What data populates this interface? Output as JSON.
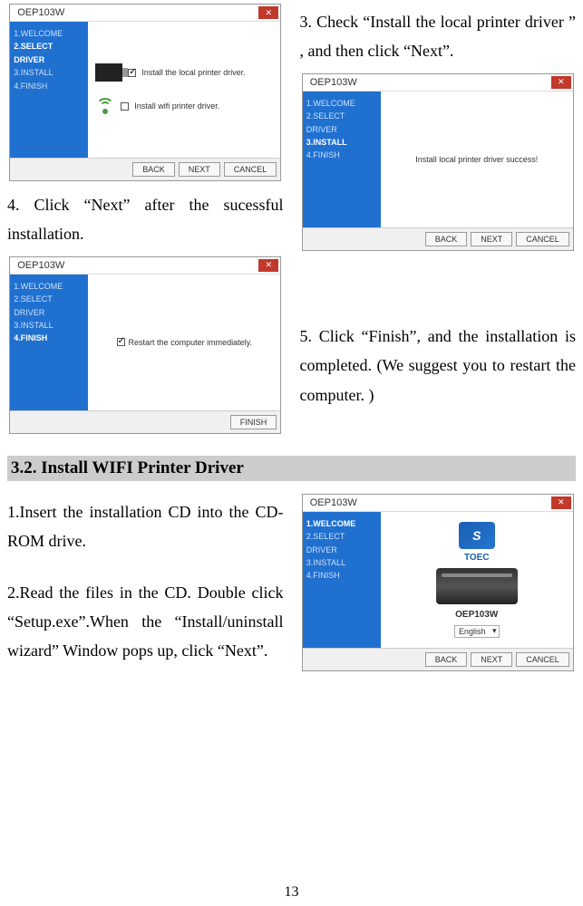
{
  "installer": {
    "title": "OEP103W",
    "close": "✕",
    "steps": {
      "s1": "1.WELCOME",
      "s2": "2.SELECT DRIVER",
      "s3": "3.INSTALL",
      "s4": "4.FINISH"
    },
    "buttons": {
      "back": "BACK",
      "next": "NEXT",
      "cancel": "CANCEL",
      "finish": "FINISH"
    },
    "options": {
      "local_label": "Install the local printer driver.",
      "wifi_label": "Install wifi printer driver."
    },
    "success_msg": "Install local printer driver success!",
    "restart_label": "Restart the computer immediately.",
    "welcome": {
      "brand": "TOEC",
      "model": "OEP103W",
      "language": "English"
    }
  },
  "text": {
    "step4": "4. Click “Next” after the sucessful installation.",
    "step3": "3. Check “Install the local printer driver ” , and then click “Next”.",
    "step5": "5. Click “Finish”, and the installation is completed. (We suggest you to restart the computer. )",
    "heading": "3.2.   Install WIFI Printer Driver",
    "wifi_step1": "1.Insert the installation CD into the CD-ROM drive.",
    "wifi_step2": "2.Read the files in the CD. Double click “Setup.exe”.When the “Install/uninstall wizard” Window pops up, click “Next”."
  },
  "page_number": "13"
}
